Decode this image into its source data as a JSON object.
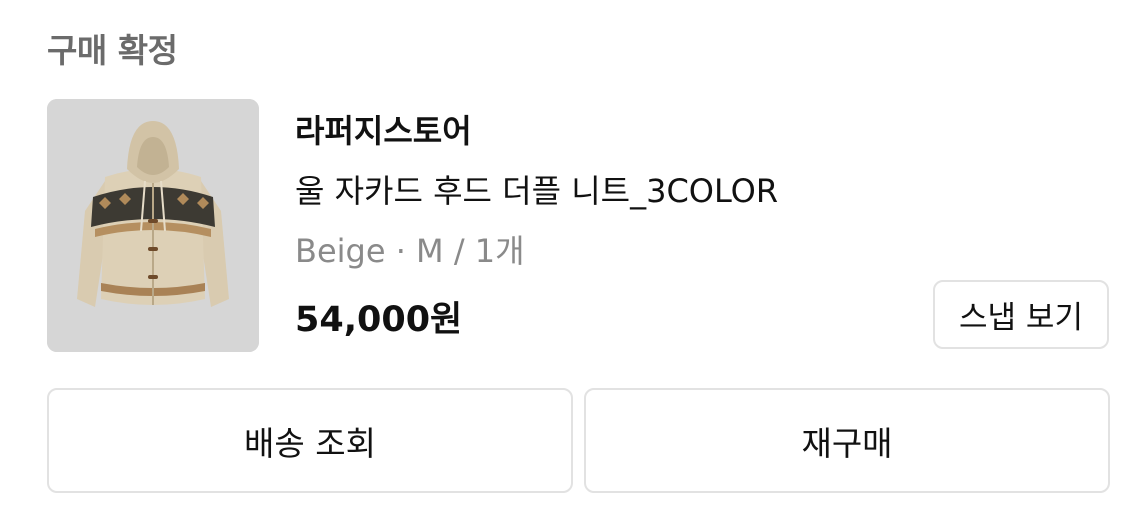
{
  "order": {
    "status": "구매 확정",
    "store_name": "라퍼지스토어",
    "product_name": "울 자카드 후드 더플 니트_3COLOR",
    "option": "Beige · M / 1개",
    "price": "54,000원",
    "snap_button_label": "스냅 보기",
    "image": "beige-hooded-knit-cardigan"
  },
  "actions": {
    "track_delivery_label": "배송 조회",
    "reorder_label": "재구매"
  },
  "colors": {
    "status_text": "#6b6b6b",
    "option_text": "#8a8a8a",
    "button_border": "#e2e2e2",
    "thumbnail_bg": "#d6d6d6"
  }
}
